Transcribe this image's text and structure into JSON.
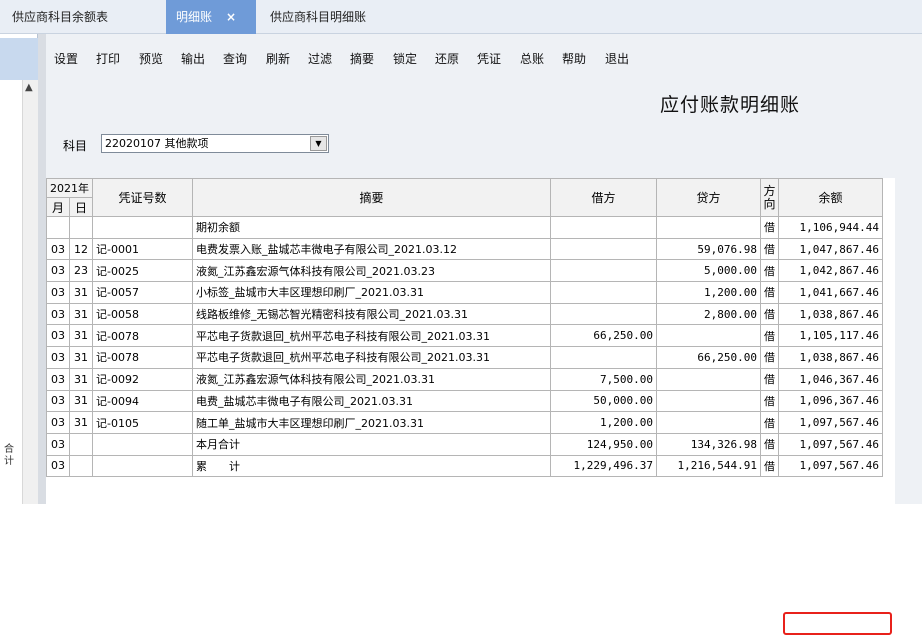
{
  "tabs": [
    {
      "label": "供应商科目余额表",
      "active": false
    },
    {
      "label": "明细账",
      "active": true,
      "close": "×"
    },
    {
      "label": "供应商科目明细账",
      "active": false
    }
  ],
  "toolbar": [
    "设置",
    "打印",
    "预览",
    "输出",
    "查询",
    "刷新",
    "过滤",
    "摘要",
    "锁定",
    "还原",
    "凭证",
    "总账",
    "帮助",
    "退出"
  ],
  "title": "应付账款明细账",
  "subject": {
    "label": "科目",
    "value": "22020107 其他款项"
  },
  "table": {
    "year": "2021年",
    "month": "月",
    "day": "日",
    "voucher_header": "凭证号数",
    "summary_header": "摘要",
    "debit_header": "借方",
    "credit_header": "贷方",
    "direction_header": "方向",
    "balance_header": "余额",
    "rows": [
      {
        "m": "",
        "d": "",
        "v": "",
        "s": "期初余额",
        "dr": "",
        "cr": "",
        "dir": "借",
        "bal": "1,106,944.44"
      },
      {
        "m": "03",
        "d": "12",
        "v": "记-0001",
        "s": "电费发票入账_盐城芯丰微电子有限公司_2021.03.12",
        "dr": "",
        "cr": "59,076.98",
        "dir": "借",
        "bal": "1,047,867.46"
      },
      {
        "m": "03",
        "d": "23",
        "v": "记-0025",
        "s": "液氮_江苏鑫宏源气体科技有限公司_2021.03.23",
        "dr": "",
        "cr": "5,000.00",
        "dir": "借",
        "bal": "1,042,867.46"
      },
      {
        "m": "03",
        "d": "31",
        "v": "记-0057",
        "s": "小标签_盐城市大丰区理想印刷厂_2021.03.31",
        "dr": "",
        "cr": "1,200.00",
        "dir": "借",
        "bal": "1,041,667.46"
      },
      {
        "m": "03",
        "d": "31",
        "v": "记-0058",
        "s": "线路板维修_无锡芯智光精密科技有限公司_2021.03.31",
        "dr": "",
        "cr": "2,800.00",
        "dir": "借",
        "bal": "1,038,867.46"
      },
      {
        "m": "03",
        "d": "31",
        "v": "记-0078",
        "s": "平芯电子货款退回_杭州平芯电子科技有限公司_2021.03.31",
        "dr": "66,250.00",
        "cr": "",
        "dir": "借",
        "bal": "1,105,117.46"
      },
      {
        "m": "03",
        "d": "31",
        "v": "记-0078",
        "s": "平芯电子货款退回_杭州平芯电子科技有限公司_2021.03.31",
        "dr": "",
        "cr": "66,250.00",
        "dir": "借",
        "bal": "1,038,867.46"
      },
      {
        "m": "03",
        "d": "31",
        "v": "记-0092",
        "s": "液氮_江苏鑫宏源气体科技有限公司_2021.03.31",
        "dr": "7,500.00",
        "cr": "",
        "dir": "借",
        "bal": "1,046,367.46"
      },
      {
        "m": "03",
        "d": "31",
        "v": "记-0094",
        "s": "电费_盐城芯丰微电子有限公司_2021.03.31",
        "dr": "50,000.00",
        "cr": "",
        "dir": "借",
        "bal": "1,096,367.46"
      },
      {
        "m": "03",
        "d": "31",
        "v": "记-0105",
        "s": "随工单_盐城市大丰区理想印刷厂_2021.03.31",
        "dr": "1,200.00",
        "cr": "",
        "dir": "借",
        "bal": "1,097,567.46"
      },
      {
        "m": "03",
        "d": "",
        "v": "",
        "s": "本月合计",
        "dr": "124,950.00",
        "cr": "134,326.98",
        "dir": "借",
        "bal": "1,097,567.46"
      },
      {
        "m": "03",
        "d": "",
        "v": "",
        "s": "累　　计",
        "dr": "1,229,496.37",
        "cr": "1,216,544.91",
        "dir": "借",
        "bal": "1,097,567.46"
      }
    ]
  },
  "left_partial_text": "合计"
}
